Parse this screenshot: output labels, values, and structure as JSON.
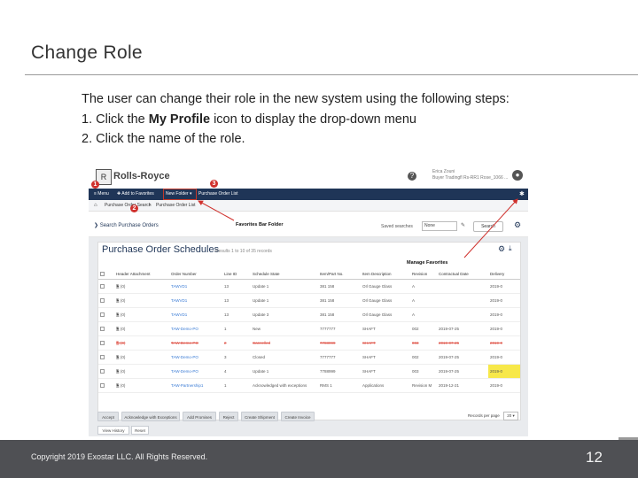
{
  "slide": {
    "title": "Change Role",
    "lines": [
      "The user can change their role in the new system using the following steps:",
      "1. Click the ",
      "My Profile",
      " icon to display the drop-down menu",
      "2. Click the name of the role."
    ]
  },
  "app": {
    "logo_text": "Rolls-Royce",
    "help_icon": "?",
    "user_name": "Erica Zouni",
    "user_meta": "Buyer Tradingfl Rs-RR1 Rose_1066 ...",
    "nav": {
      "menu": "≡ Menu",
      "add_favorites": "✚ Add to Favorites",
      "favorite_folder": "New Folder ▾",
      "purchase_order_list": "Purchase Order List"
    },
    "breadcrumbs": [
      "Purchase Order Search",
      "Purchase Order List"
    ],
    "search_panel": {
      "title": "Search Purchase Orders",
      "saved_searches_label": "Saved searches",
      "saved_searches_value": "None",
      "search_button": "Search"
    },
    "annotations": {
      "favorites_bar_folder": "Favorites Bar Folder",
      "manage_favorites": "Manage Favorites",
      "markers": [
        "1",
        "2",
        "3"
      ]
    },
    "grid": {
      "title": "Purchase Order Schedules",
      "subtitle": "Results 1 to 10 of 35 records",
      "columns": [
        "",
        "Header Attachment",
        "Order Number",
        "Line ID",
        "Schedule State",
        "Item/Part No.",
        "Item Description",
        "Revision",
        "Contractual Date",
        "Delivery"
      ],
      "rows": [
        {
          "att": "🗎 (0)",
          "order": "TAWVD1",
          "line": "13",
          "state": "Update 1",
          "part": "381 158",
          "desc": "OIl Gauge Glass",
          "rev": "A",
          "date": "",
          "deliv": "2019-0",
          "style": ""
        },
        {
          "att": "🗎 (0)",
          "order": "TAWVD1",
          "line": "13",
          "state": "Update 1",
          "part": "381 158",
          "desc": "OIl Gauge Glass",
          "rev": "A",
          "date": "",
          "deliv": "2019-0",
          "style": ""
        },
        {
          "att": "🗎 (0)",
          "order": "TAWVD1",
          "line": "13",
          "state": "Update 3",
          "part": "381 158",
          "desc": "OIl Gauge Glass",
          "rev": "A",
          "date": "",
          "deliv": "2019-0",
          "style": ""
        },
        {
          "att": "🗎 (0)",
          "order": "TAW-Demo-PO",
          "line": "1",
          "state": "New",
          "part": "7777777",
          "desc": "SHAFT",
          "rev": "002",
          "date": "2019-07-25",
          "deliv": "2019-0",
          "style": ""
        },
        {
          "att": "🗎 (0)",
          "order": "TAW-Demo-PO",
          "line": "2",
          "state": "Cancelled",
          "part": "7788999",
          "desc": "SHAFT",
          "rev": "003",
          "date": "2019-07-25",
          "deliv": "2019-0",
          "style": "cancelled"
        },
        {
          "att": "🗎 (0)",
          "order": "TAW-Demo-PO",
          "line": "3",
          "state": "Closed",
          "part": "7777777",
          "desc": "SHAFT",
          "rev": "002",
          "date": "2019-07-25",
          "deliv": "2019-0",
          "style": ""
        },
        {
          "att": "🗎 (0)",
          "order": "TAW-Demo-PO",
          "line": "4",
          "state": "Update 1",
          "part": "7788999",
          "desc": "SHAFT",
          "rev": "003",
          "date": "2019-07-25",
          "deliv": "2019-0",
          "style": "hl"
        },
        {
          "att": "🗎 (0)",
          "order": "TAW-Partnership1",
          "line": "1",
          "state": "Acknowledged with exceptions",
          "part": "RMS 1",
          "desc": "Applications",
          "rev": "Revision M",
          "date": "2019-12-21",
          "deliv": "2019-0",
          "style": ""
        }
      ]
    },
    "actions": [
      "Accept",
      "Acknowledge with Exceptions",
      "Add Promises",
      "Reject",
      "Create Shipment",
      "Create Invoice"
    ],
    "rows_per_page_label": "Records per page",
    "rows_per_page_value": "20 ▾",
    "bottom_tabs": [
      "View History",
      "Reset"
    ]
  },
  "footer": {
    "copyright": "Copyright 2019 Exostar LLC. All Rights Reserved.",
    "page_number": "12"
  },
  "colors": {
    "nav_bar": "#1f3557",
    "footer_bg": "#4f5054",
    "annotation_red": "#d0312d",
    "link_blue": "#3a7bd5",
    "highlight_yellow": "#f7e84a"
  }
}
